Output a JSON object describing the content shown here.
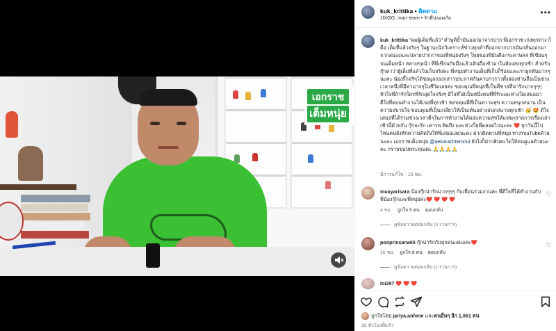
{
  "video": {
    "caption_line1": "เอกราช",
    "caption_line2": "เต็มหนุ่ย",
    "mute_icon": "speaker-mute-icon"
  },
  "header": {
    "username": "kuk_krittika",
    "separator": " • ",
    "follow_label": "ติดตาม",
    "subtitle": "JIXGO, marr team • รักที่ปลอดภัย",
    "more_icon": "more-options-icon"
  },
  "caption": {
    "username": "kuk_krittika",
    "text_before_mention": "\"ผมผู้เต็มที่แล้ว\" คำพูดีย้ำมันออกมาจากปาก พี่เอกราช เก่งทุกทาง ก็ดีอ เต็มที่แล้วจริงๆ ในฐานะนักวิเคราะห์ข่าวทุกคำที่ออกจากปากมันกลั่นออกมาจากสมองและปลายปากกาของพี่หนุ่ยจริงๆ โพยของพี่มันคือกระดาษA4 ที่เขียนๆจนเต็มหน้า หลายๆหน้า ที่พี่เขียนกับมือแล้วเดินถือเข้ามาในห้องส่งทุกเช้า สำหรับกุ๊กต่าว่าผู้เต็มที่แล้วในเก็บจริงคะ พี่หนุ่ยทำงานเต็มที่เก็บก็ร้อยและเราผูกพันมากๆนะคะ น้องกิ๊กจริๆได้ช่อมูลรองกล่าวประกาศกันคาบกวราวทั้งสองท่านถือเป็นช่วงเวลาหนึ่งที่มีค่ามากๆในชีวิตเลยค่ะ ขอบคุณพี่หนุ่ยที่เป็นพี่ชายที่น่ารักมากๆๆๆ หัวใจพี่ถ้ารักใครพี่รักสุดใจจริงๆ ดีใจที่ได้เป็นหนึ่งคนที่พี่รักและห่วงใยเสมอมา ดีใจที่ตอนทำงานได้เจอพี่ทุกเช้า ขอบคุณพี่ที่เป็นความสุข ความสนุกสนาน เป็นความสบายใจ ขอบคุณที่เป็นเกลียวให้เป็นเต้นอย่างสนุกสนานทุกเช้า 🥳 🤩 ดีใจเสมอที่ได้ร่วมช่วงเวลาดีๆในการทำงานได้มอบความสุขให้แฟนๆรายการเรื่องเล่าเช้านี้ด้วยกัน กุ๊กจะรัก เคารพ คิดถึง และห่วงใยพี่ตลอดไปนะคะ ❤️ ทุกวันนี้ไปไหนคนยังทักความคิดถึงให้พี่เสมอเลยนะคะ ฝากติดตามพี่หนุ่ย ทางYouTubeด้วยนะคะ เอกราชเต็มหนุ่ย ",
    "mention": "@aekarachtemnui",
    "text_after_mention": " ยังไงก็ฝากสิบตะใดให้คนดูแลด้วยนะคะ กราบขอบพระคุณค่ะ 🙏🙏🙏🙏",
    "meta": "มีการแก้ไข · 16 ชม."
  },
  "comments": [
    {
      "username": "muayarisara",
      "text": " น้องกุ๊กน่ารักมากๆๆๆ กับเพื่อนร่วมงานค่ะ พี่ดีใจที่ได้ทำงานกับพี่น้องกุ๊กและพี่หนุ่ยค่ะ❤️ ❤️ ❤️ ❤️",
      "time": "4 ชม.",
      "likes": "ถูกใจ 5 คน",
      "reply": "ตอบกลับ",
      "view_replies": "ดูข้อความตอบกลับ (3 รายการ)"
    },
    {
      "username": "pooprissana65",
      "text": " กุ๊กน่ารักกับทุกคนเสมอค่ะ❤️",
      "time": "16 ชม.",
      "likes": "ถูกใจ 8 คน",
      "reply": "ตอบกลับ",
      "view_replies": "ดูข้อความตอบกลับ (1 รายการ)"
    },
    {
      "username": "loi297",
      "text": " ❤️ ❤️ ❤️"
    }
  ],
  "actions": {
    "like_icon": "heart-icon",
    "comment_icon": "comment-icon",
    "repost_icon": "repost-icon",
    "share_icon": "share-icon",
    "save_icon": "bookmark-icon"
  },
  "likes": {
    "prefix": "ถูกใจโดย ",
    "user": "jariya.anfone",
    "middle": " และ",
    "others": "คนอื่นๆ อีก 1,951 คน"
  },
  "posted": "16 ชั่วโมงที่แล้ว",
  "colors": {
    "accent": "#0095f6",
    "caption_green": "#2aa946",
    "shirt_green": "#3bbf33"
  }
}
